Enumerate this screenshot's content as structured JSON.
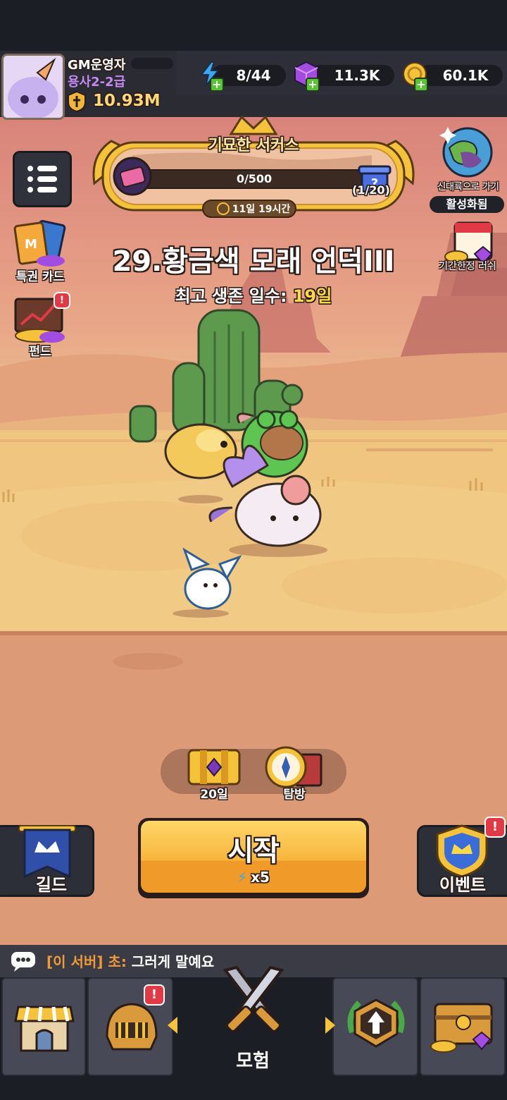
{
  "player": {
    "name": "GM운영자",
    "rank": "용사2-2급",
    "power": "10.93M"
  },
  "resources": {
    "energy": "8/44",
    "gems": "11.3K",
    "coins": "60.1K"
  },
  "event_banner": {
    "title": "기묘한 서커스",
    "progress": "0/500",
    "progress_fraction": 0,
    "reward_count": "(1/20)",
    "timer": "11일 19시간"
  },
  "right_top": {
    "new_continent_label": "신대륙으로 가기",
    "activated_label": "활성화됨",
    "limited_rush_label": "기간한정 러쉬"
  },
  "left_side": {
    "privilege_card": "특권 카드",
    "fund": "펀드"
  },
  "stage": {
    "title": "29.황금색 모래 언덕III",
    "best_prefix": "최고 생존 일수: ",
    "best_days": "19일"
  },
  "mid_actions": {
    "chest_label": "20일",
    "explore_label": "탐방"
  },
  "start_button": {
    "label": "시작",
    "cost": "x5"
  },
  "guild_label": "길드",
  "event_label": "이벤트",
  "chat": {
    "channel": "[이 서버]",
    "speaker": "초:",
    "message": "그러게 말예요"
  },
  "nav": {
    "active_label": "모험"
  },
  "colors": {
    "accent_yellow": "#f5c23c",
    "energy_blue": "#39a8f0",
    "gem_purple": "#a34de0",
    "alert_red": "#e03a47"
  }
}
